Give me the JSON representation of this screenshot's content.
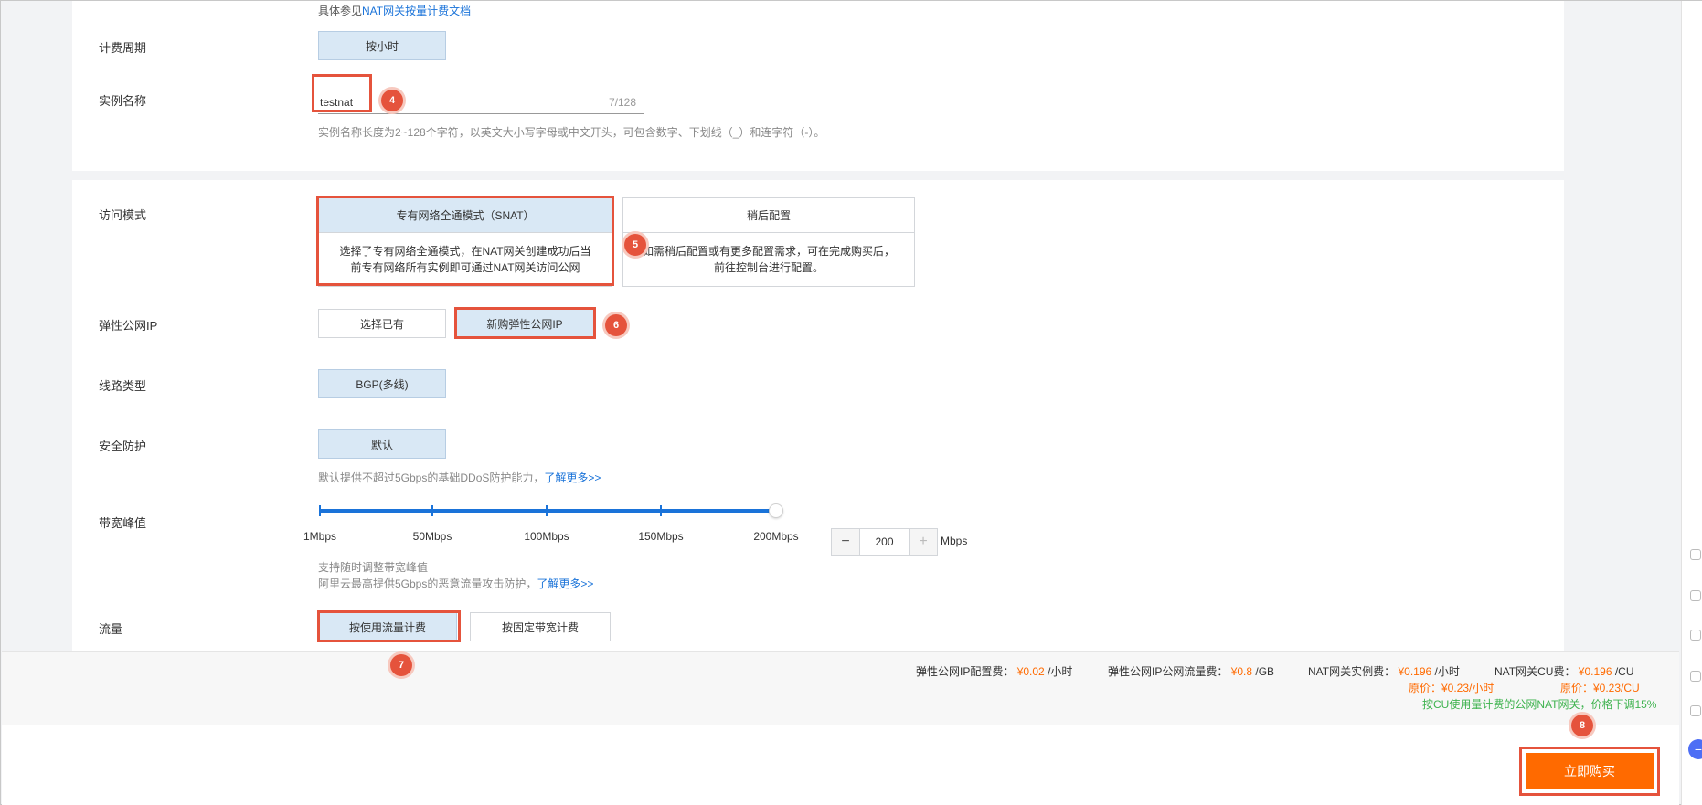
{
  "top_note": {
    "prefix": "具体参见",
    "link": "NAT网关按量计费文档"
  },
  "billing_cycle": {
    "label": "计费周期",
    "option": "按小时"
  },
  "instance_name": {
    "label": "实例名称",
    "value": "testnat",
    "counter": "7/128",
    "hint": "实例名称长度为2~128个字符，以英文大小写字母或中文开头，可包含数字、下划线（_）和连字符（-）。"
  },
  "access_mode": {
    "label": "访问模式",
    "options": [
      {
        "title": "专有网络全通模式（SNAT）",
        "desc": "选择了专有网络全通模式，在NAT网关创建成功后当前专有网络所有实例即可通过NAT网关访问公网"
      },
      {
        "title": "稍后配置",
        "desc": "如需稍后配置或有更多配置需求，可在完成购买后，前往控制台进行配置。"
      }
    ]
  },
  "eip": {
    "label": "弹性公网IP",
    "options": [
      "选择已有",
      "新购弹性公网IP"
    ]
  },
  "line_type": {
    "label": "线路类型",
    "option": "BGP(多线)"
  },
  "security": {
    "label": "安全防护",
    "option": "默认",
    "hint": "默认提供不超过5Gbps的基础DDoS防护能力，",
    "link": "了解更多>>"
  },
  "bandwidth": {
    "label": "带宽峰值",
    "ticks": [
      "1Mbps",
      "50Mbps",
      "100Mbps",
      "150Mbps",
      "200Mbps"
    ],
    "value": "200",
    "unit": "Mbps",
    "level_fraction": 1.0,
    "hint1": "支持随时调整带宽峰值",
    "hint2": "阿里云最高提供5Gbps的恶意流量攻击防护，",
    "link": "了解更多>>"
  },
  "traffic": {
    "label": "流量",
    "options": [
      "按使用流量计费",
      "按固定带宽计费"
    ]
  },
  "fees": {
    "eip_config": {
      "label": "弹性公网IP配置费：",
      "price": "¥0.02",
      "unit": "/小时"
    },
    "eip_traffic": {
      "label": "弹性公网IP公网流量费：",
      "price": "¥0.8",
      "unit": "/GB"
    },
    "nat_instance": {
      "label": "NAT网关实例费：",
      "price": "¥0.196",
      "unit": "/小时",
      "original": "原价：¥0.23/小时"
    },
    "nat_cu": {
      "label": "NAT网关CU费：",
      "price": "¥0.196",
      "unit": "/CU",
      "original": "原价：¥0.23/CU"
    },
    "promo": "按CU使用量计费的公网NAT网关，价格下调15%"
  },
  "buy_button": "立即购买",
  "markers": [
    "4",
    "5",
    "6",
    "7",
    "8"
  ],
  "colors": {
    "accent": "#1a73d9",
    "highlight": "#e5533c",
    "buy": "#ff6a00",
    "selected": "#d9e8f5"
  }
}
